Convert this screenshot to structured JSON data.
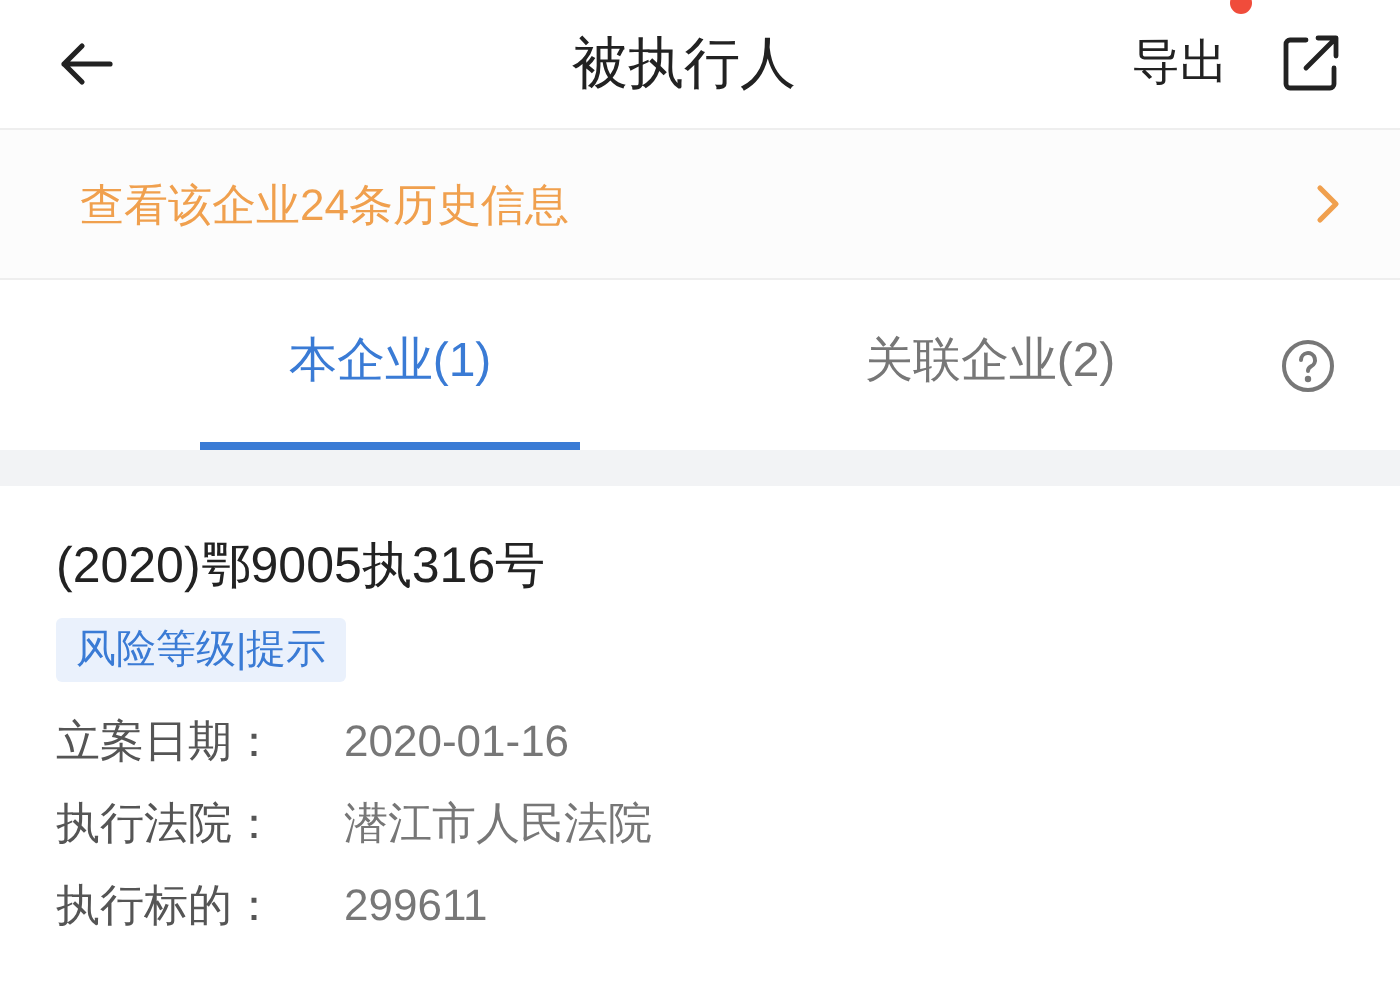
{
  "header": {
    "title": "被执行人",
    "export_label": "导出",
    "notification_dot": true
  },
  "history_banner": {
    "text": "查看该企业24条历史信息"
  },
  "tabs": [
    {
      "label": "本企业(1)",
      "selected": true
    },
    {
      "label": "关联企业(2)",
      "selected": false
    }
  ],
  "record": {
    "case_number": "(2020)鄂9005执316号",
    "tag": "风险等级|提示",
    "fields": [
      {
        "label": "立案日期：",
        "value": "2020-01-16"
      },
      {
        "label": "执行法院：",
        "value": "潜江市人民法院"
      },
      {
        "label": "执行标的：",
        "value": "299611"
      }
    ]
  }
}
